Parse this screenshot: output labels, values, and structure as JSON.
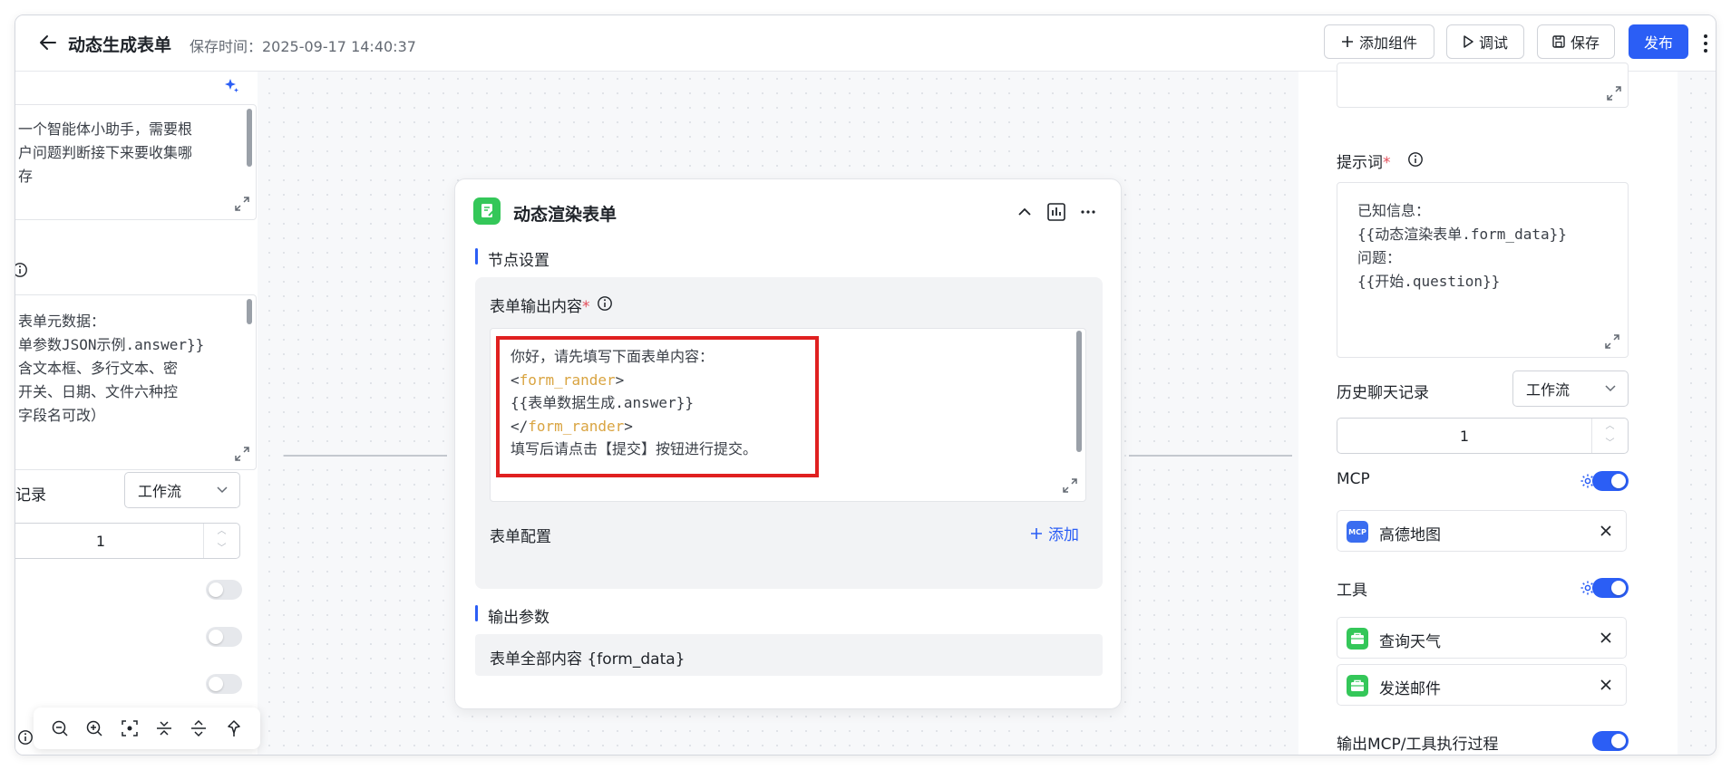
{
  "header": {
    "title": "动态生成表单",
    "save_time": "保存时间：2025-09-17 14:40:37",
    "buttons": {
      "add_component": "添加组件",
      "debug": "调试",
      "save": "保存",
      "publish": "发布"
    }
  },
  "left_panel": {
    "textbox1_lines": [
      "一个智能体小助手，需要根",
      "户问题判断接下来要收集哪",
      "存"
    ],
    "textbox2_lines": [
      "表单元数据：",
      "单参数JSON示例.answer}}",
      "含文本框、多行文本、密",
      "开关、日期、文件六种控",
      "字段名可改）"
    ],
    "history_label": "记录",
    "history_select": "工作流",
    "history_count": "1"
  },
  "node": {
    "title": "动态渲染表单",
    "section_settings": "节点设置",
    "form_output_label": "表单输出内容",
    "form_output_required": "*",
    "content_lines": [
      {
        "pre": "你好，请先填写下面表单内容：",
        "tag": "",
        "post": ""
      },
      {
        "pre": "<",
        "tag": "form_rander",
        "post": ">"
      },
      {
        "pre": "{{表单数据生成.answer}}",
        "tag": "",
        "post": ""
      },
      {
        "pre": "</",
        "tag": "form_rander",
        "post": ">"
      },
      {
        "pre": "填写后请点击【提交】按钮进行提交。",
        "tag": "",
        "post": ""
      }
    ],
    "form_config_label": "表单配置",
    "add_label": "添加",
    "section_output": "输出参数",
    "output_param": "表单全部内容 {form_data}"
  },
  "right_panel": {
    "prompt_label": "提示词",
    "prompt_required": "*",
    "prompt_lines": [
      "已知信息：",
      "{{动态渲染表单.form_data}}",
      "问题：",
      "{{开始.question}}"
    ],
    "history_label": "历史聊天记录",
    "history_select": "工作流",
    "history_count": "1",
    "mcp_label": "MCP",
    "mcp_items": [
      {
        "name": "高德地图",
        "icon_text": "MCP"
      }
    ],
    "tools_label": "工具",
    "tool_items": [
      {
        "name": "查询天气"
      },
      {
        "name": "发送邮件"
      }
    ],
    "output_process_label": "输出MCP/工具执行过程"
  },
  "colors": {
    "accent": "#2b5ef5",
    "highlight_border": "#e02020",
    "tag_color": "#d9a441",
    "node_icon": "#34c759"
  }
}
